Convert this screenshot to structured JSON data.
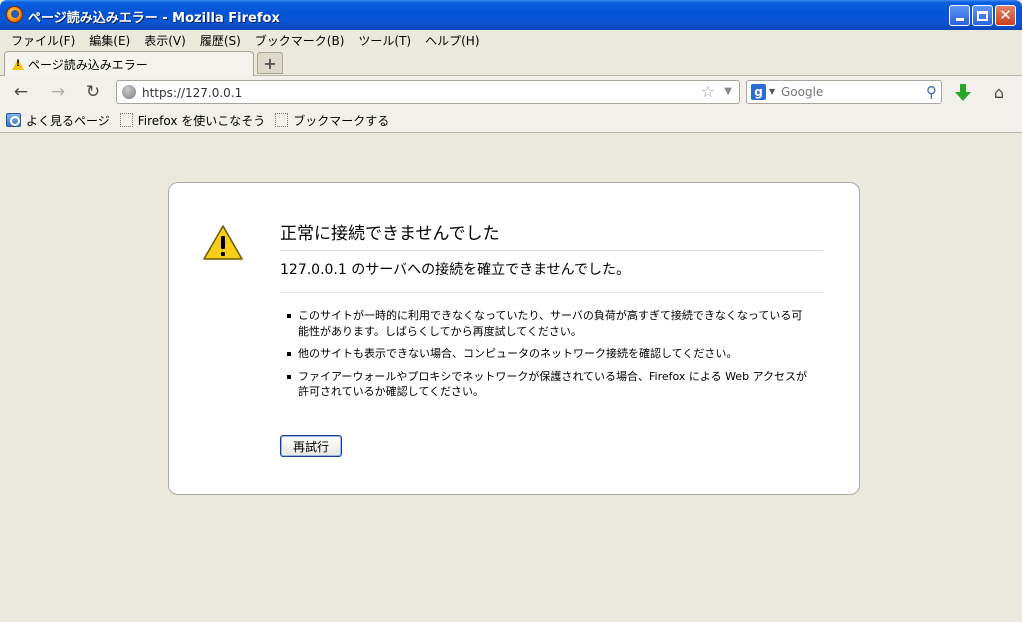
{
  "window": {
    "title": "ページ読み込みエラー - Mozilla Firefox",
    "icon": "firefox-logo",
    "controls": [
      "minimize",
      "maximize",
      "close"
    ]
  },
  "menubar": {
    "items": [
      "ファイル(F)",
      "編集(E)",
      "表示(V)",
      "履歴(S)",
      "ブックマーク(B)",
      "ツール(T)",
      "ヘルプ(H)"
    ]
  },
  "tabs": [
    {
      "label": "ページ読み込みエラー",
      "icon": "warning-icon",
      "active": true
    }
  ],
  "newtab_label": "+",
  "navbar": {
    "url": "https://127.0.0.1",
    "search_placeholder": "Google",
    "icons": [
      "back-icon",
      "forward-icon",
      "reload-icon",
      "bookmark-star-icon",
      "search-icon",
      "download-icon",
      "home-icon"
    ]
  },
  "bookmarks": [
    {
      "label": "よく見るページ",
      "icon": "smart-folder-icon"
    },
    {
      "label": "Firefox を使いこなそう",
      "icon": "page-icon"
    },
    {
      "label": "ブックマークする",
      "icon": "page-icon"
    }
  ],
  "error": {
    "title": "正常に接続できませんでした",
    "short_desc": "127.0.0.1 のサーバへの接続を確立できませんでした。",
    "items": [
      "このサイトが一時的に利用できなくなっていたり、サーバの負荷が高すぎて接続できなくなっている可能性があります。しばらくしてから再度試してください。",
      "他のサイトも表示できない場合、コンピュータのネットワーク接続を確認してください。",
      "ファイアーウォールやプロキシでネットワークが保護されている場合、Firefox による Web アクセスが許可されているか確認してください。"
    ],
    "retry_label": "再試行"
  },
  "colors": {
    "titlebar": "#0554d6",
    "chrome_bg": "#ebe9dc",
    "warning_yellow": "#f2c40d"
  }
}
